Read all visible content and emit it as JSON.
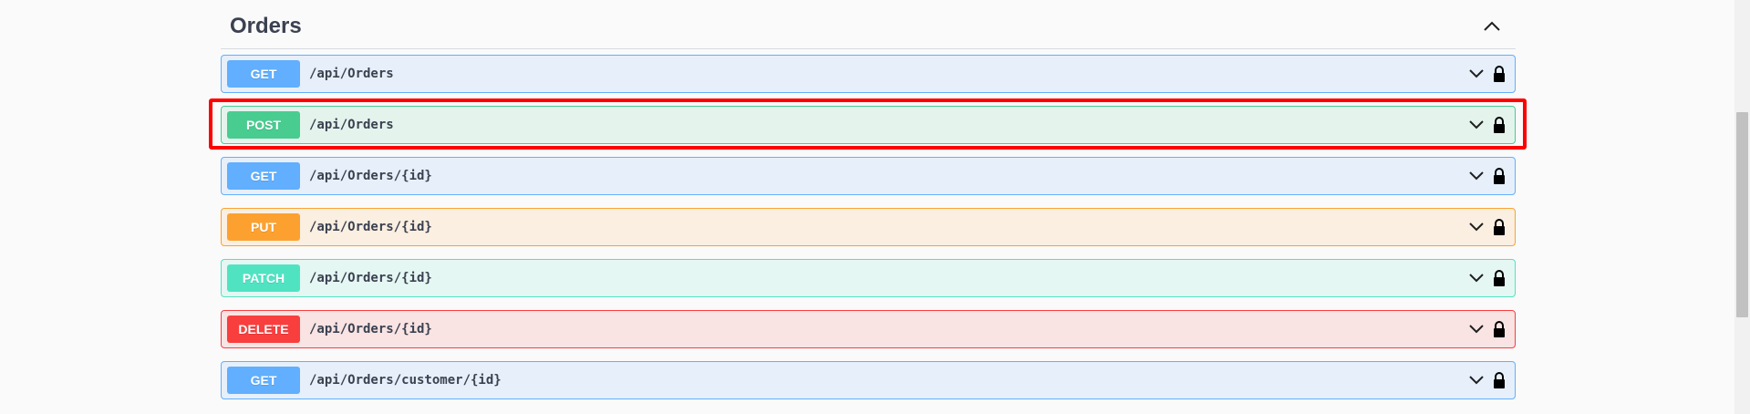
{
  "section": {
    "title": "Orders",
    "collapse_icon": "chevron-up-icon"
  },
  "operations": [
    {
      "method": "GET",
      "path": "/api/Orders",
      "type": "get",
      "color": "#61affe"
    },
    {
      "method": "POST",
      "path": "/api/Orders",
      "type": "post",
      "color": "#49cc90",
      "highlighted": true
    },
    {
      "method": "GET",
      "path": "/api/Orders/{id}",
      "type": "get",
      "color": "#61affe"
    },
    {
      "method": "PUT",
      "path": "/api/Orders/{id}",
      "type": "put",
      "color": "#fca130"
    },
    {
      "method": "PATCH",
      "path": "/api/Orders/{id}",
      "type": "patch",
      "color": "#50e3c2"
    },
    {
      "method": "DELETE",
      "path": "/api/Orders/{id}",
      "type": "delete",
      "color": "#f93e3e"
    },
    {
      "method": "GET",
      "path": "/api/Orders/customer/{id}",
      "type": "get",
      "color": "#61affe"
    }
  ],
  "row_icons": [
    "chevron-down-icon",
    "lock-icon"
  ],
  "colors": {
    "highlight": "#ff0000",
    "title": "#3b4151"
  }
}
